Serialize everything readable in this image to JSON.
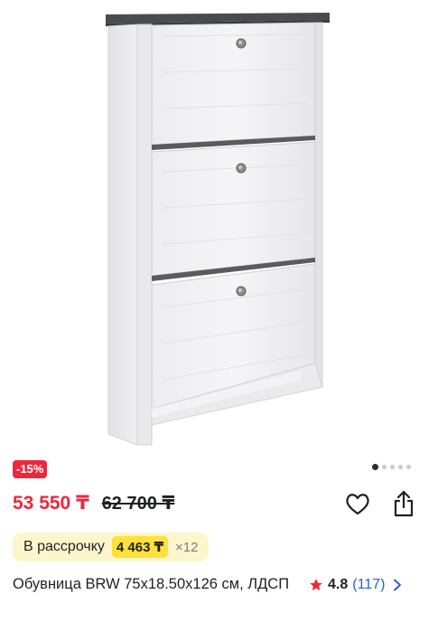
{
  "product": {
    "image_name": "shoe-cabinet-image",
    "discount": "-15%",
    "price": "53 550 ₸",
    "old_price": "62 700 ₸",
    "installment": {
      "label": "В рассрочку",
      "amount": "4 463 ₸",
      "months": "×12"
    },
    "title": "Обувница BRW 75x18.50x126 см, ЛДСП",
    "rating": "4.8",
    "reviews": "(117)"
  },
  "carousel": {
    "dots": 5,
    "active_index": 0
  },
  "icons": {
    "favorite": "heart-icon",
    "share": "share-icon",
    "rating_star": "star-icon",
    "reviews_link": "chevron-right-icon"
  },
  "colors": {
    "accent_red": "#f0263c",
    "installment_bg": "#fdf5cc",
    "installment_highlight": "#ffe13a",
    "link_blue": "#2b62c9"
  }
}
